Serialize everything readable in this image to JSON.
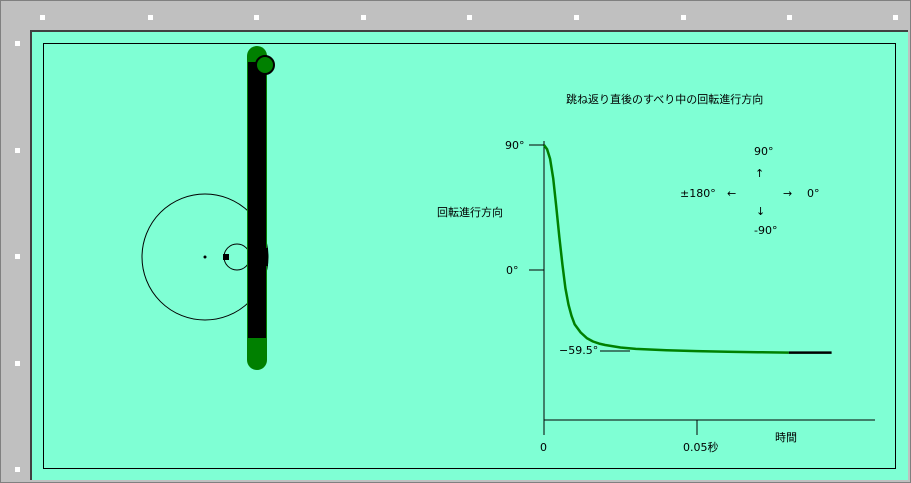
{
  "chart_data": {
    "type": "line",
    "title": "跳ね返り直後のすべり中の回転進行方向",
    "ylabel": "回転進行方向",
    "xlabel": "時間",
    "y_ticks": [
      "90°",
      "0°"
    ],
    "x_ticks": [
      "0",
      "0.05秒"
    ],
    "annotation": "−59.5°",
    "compass": {
      "up": "90°",
      "right": "0°",
      "left": "±180°",
      "down": "-90°",
      "arrow_up": "↑",
      "arrow_down": "↓",
      "arrow_left": "←",
      "arrow_right": "→"
    },
    "xlim": [
      0,
      0.11
    ],
    "ylim": [
      -90,
      90
    ],
    "series": [
      {
        "color": "#008000",
        "x": [
          0,
          0.001,
          0.002,
          0.003,
          0.004,
          0.005,
          0.006,
          0.007,
          0.008,
          0.009,
          0.01,
          0.012,
          0.014,
          0.016,
          0.018,
          0.02,
          0.025,
          0.03,
          0.04,
          0.05,
          0.06,
          0.07,
          0.08
        ],
        "y": [
          90,
          87,
          80,
          66,
          46,
          24,
          4,
          -13,
          -25,
          -33,
          -39,
          -45,
          -49,
          -51.5,
          -53,
          -54,
          -55.8,
          -56.8,
          -57.8,
          -58.4,
          -58.9,
          -59.2,
          -59.5
        ]
      },
      {
        "color": "#000000",
        "x": [
          0.08,
          0.083,
          0.086,
          0.09,
          0.094
        ],
        "y": [
          -59.5,
          -59.5,
          -59.5,
          -59.5,
          -59.5
        ]
      }
    ]
  },
  "colors": {
    "canvas": "#7fffd4",
    "cue_body": "#000000",
    "cue_ends": "#008000"
  }
}
